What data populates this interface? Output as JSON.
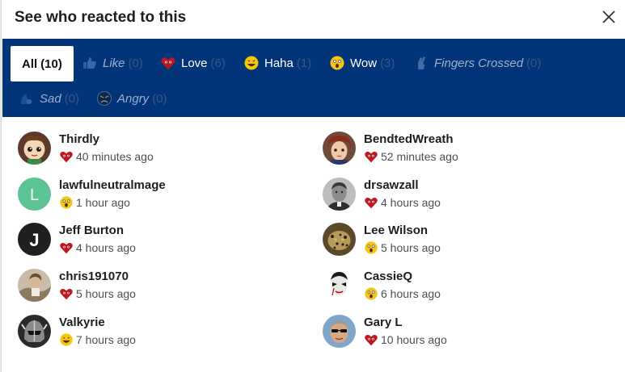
{
  "dialog": {
    "title": "See who reacted to this"
  },
  "tabs": [
    {
      "label": "All",
      "count": "(10)",
      "icon": "",
      "active": true
    },
    {
      "label": "Like",
      "count": "(0)",
      "icon": "like-icon"
    },
    {
      "label": "Love",
      "count": "(6)",
      "icon": "love-icon"
    },
    {
      "label": "Haha",
      "count": "(1)",
      "icon": "haha-icon"
    },
    {
      "label": "Wow",
      "count": "(3)",
      "icon": "wow-icon"
    },
    {
      "label": "Fingers Crossed",
      "count": "(0)",
      "icon": "fingers-crossed-icon"
    },
    {
      "label": "Sad",
      "count": "(0)",
      "icon": "sad-icon"
    },
    {
      "label": "Angry",
      "count": "(0)",
      "icon": "angry-icon"
    }
  ],
  "people": [
    {
      "name": "Thirdly",
      "time": "40 minutes ago",
      "reaction": "love",
      "avatar": "cartoon-avatar"
    },
    {
      "name": "BendtedWreath",
      "time": "52 minutes ago",
      "reaction": "love",
      "avatar": "anime-avatar"
    },
    {
      "name": "lawfulneutralmage",
      "time": "1 hour ago",
      "reaction": "wow",
      "avatar_letter": "L",
      "avatar_color": "#5cc494"
    },
    {
      "name": "drsawzall",
      "time": "4 hours ago",
      "reaction": "love",
      "avatar": "portrait-avatar"
    },
    {
      "name": "Jeff Burton",
      "time": "4 hours ago",
      "reaction": "love",
      "avatar_letter": "J",
      "avatar_color": "#1f1f1f"
    },
    {
      "name": "Lee Wilson",
      "time": "5 hours ago",
      "reaction": "wow",
      "avatar": "leopard-avatar"
    },
    {
      "name": "chris191070",
      "time": "5 hours ago",
      "reaction": "love",
      "avatar": "photo-avatar"
    },
    {
      "name": "CassieQ",
      "time": "6 hours ago",
      "reaction": "wow",
      "avatar": "facepaint-avatar"
    },
    {
      "name": "Valkyrie",
      "time": "7 hours ago",
      "reaction": "haha",
      "avatar": "helmet-avatar"
    },
    {
      "name": "Gary L",
      "time": "10 hours ago",
      "reaction": "love",
      "avatar": "sunglasses-avatar"
    }
  ],
  "colors": {
    "tab_bar": "#023479",
    "love": "#c0171f",
    "wow": "#f5c518"
  }
}
